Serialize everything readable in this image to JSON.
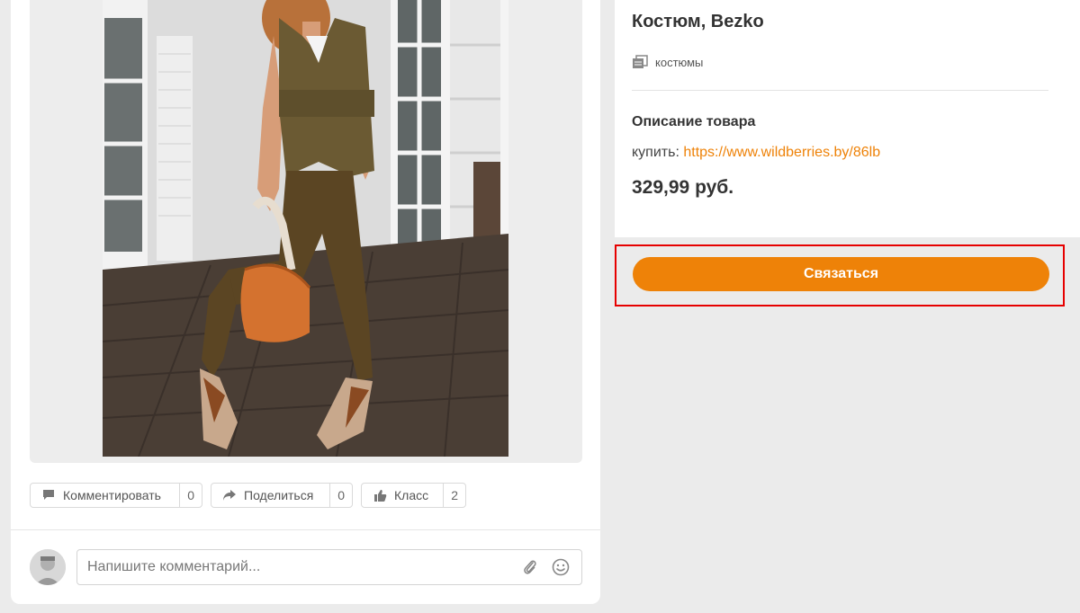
{
  "post": {
    "actions": [
      {
        "label": "Комментировать",
        "count": "0",
        "icon": "comment-icon"
      },
      {
        "label": "Поделиться",
        "count": "0",
        "icon": "share-icon"
      },
      {
        "label": "Класс",
        "count": "2",
        "icon": "thumbs-up-icon"
      }
    ],
    "comment": {
      "placeholder": "Напишите комментарий...",
      "attach_icon": "paperclip-icon",
      "emoji_icon": "smiley-icon"
    }
  },
  "product": {
    "title": "Костюм, Bezko",
    "category": "костюмы",
    "description_heading": "Описание товара",
    "buy_prefix": "купить:",
    "buy_link": "https://www.wildberries.by/86lb",
    "price": "329,99 руб.",
    "contact_label": "Связаться"
  },
  "colors": {
    "accent": "#ee8208",
    "highlight_border": "#e60000",
    "background": "#ebebeb"
  }
}
